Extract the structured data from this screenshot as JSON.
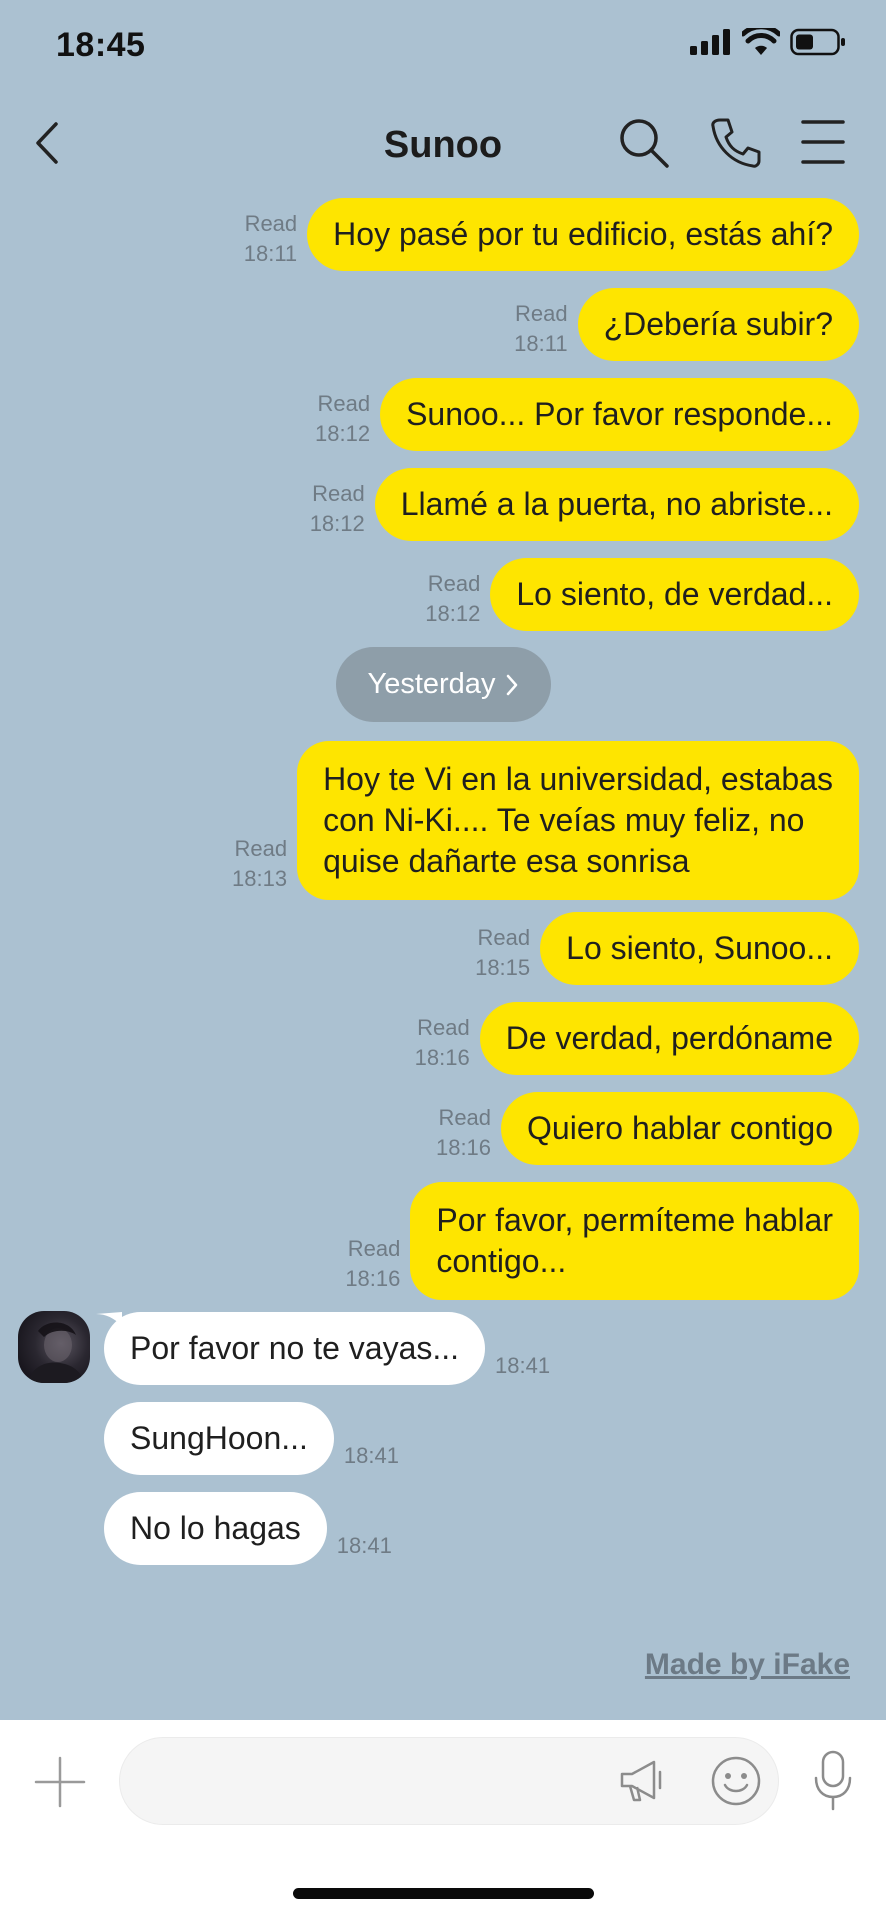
{
  "status_bar": {
    "time": "18:45"
  },
  "header": {
    "title": "Sunoo"
  },
  "divider": {
    "label": "Yesterday"
  },
  "messages": [
    {
      "side": "sent",
      "text": "Hoy pasé por tu edificio, estás ahí?",
      "status": "Read",
      "time": "18:11"
    },
    {
      "side": "sent",
      "text": "¿Debería subir?",
      "status": "Read",
      "time": "18:11"
    },
    {
      "side": "sent",
      "text": "Sunoo... Por favor responde...",
      "status": "Read",
      "time": "18:12"
    },
    {
      "side": "sent",
      "text": "Llamé a la puerta, no abriste...",
      "status": "Read",
      "time": "18:12"
    },
    {
      "side": "sent",
      "text": "Lo siento, de verdad...",
      "status": "Read",
      "time": "18:12"
    },
    {
      "side": "sent",
      "text": "Hoy te Vi en la universidad, estabas\ncon Ni-Ki.... Te veías muy feliz, no\nquise dañarte esa sonrisa",
      "status": "Read",
      "time": "18:13"
    },
    {
      "side": "sent",
      "text": "Lo siento, Sunoo...",
      "status": "Read",
      "time": "18:15"
    },
    {
      "side": "sent",
      "text": "De verdad, perdóname",
      "status": "Read",
      "time": "18:16"
    },
    {
      "side": "sent",
      "text": "Quiero hablar contigo",
      "status": "Read",
      "time": "18:16"
    },
    {
      "side": "sent",
      "text": "Por favor, permíteme hablar\ncontigo...",
      "status": "Read",
      "time": "18:16"
    },
    {
      "side": "received",
      "text": "Por favor no te vayas...",
      "time": "18:41"
    },
    {
      "side": "received",
      "text": "SungHoon...",
      "time": "18:41"
    },
    {
      "side": "received",
      "text": "No lo hagas",
      "time": "18:41"
    }
  ],
  "watermark": "Made by iFake",
  "icons": {
    "back": "chevron-left-icon",
    "search": "search-icon",
    "call": "phone-icon",
    "menu": "menu-icon",
    "plus": "plus-icon",
    "megaphone": "megaphone-icon",
    "emoji": "emoji-icon",
    "mic": "mic-icon"
  },
  "colors": {
    "background": "#abc1d1",
    "sent_bubble": "#fee500",
    "received_bubble": "#ffffff",
    "date_pill": "#8e9ea9"
  }
}
